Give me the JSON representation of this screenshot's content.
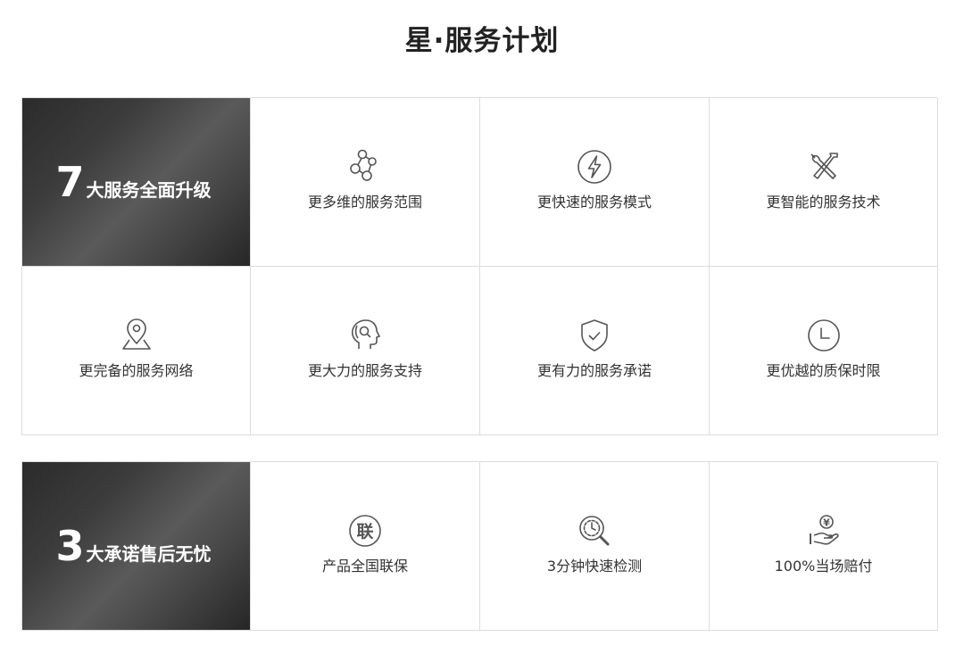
{
  "page": {
    "title": "星·服务计划"
  },
  "upgrades": {
    "hero": {
      "number": "7",
      "text": "大服务全面升级"
    },
    "items": [
      {
        "label": "更多维的服务范围",
        "icon": "molecule-icon"
      },
      {
        "label": "更快速的服务模式",
        "icon": "lightning-icon"
      },
      {
        "label": "更智能的服务技术",
        "icon": "tools-icon"
      },
      {
        "label": "更完备的服务网络",
        "icon": "location-pin-icon"
      },
      {
        "label": "更大力的服务支持",
        "icon": "head-support-icon"
      },
      {
        "label": "更有力的服务承诺",
        "icon": "shield-check-icon"
      },
      {
        "label": "更优越的质保时限",
        "icon": "clock-icon"
      }
    ]
  },
  "promises": {
    "hero": {
      "number": "3",
      "text": "大承诺售后无忧"
    },
    "items": [
      {
        "label": "产品全国联保",
        "icon": "lian-badge-icon",
        "badge_text": "联"
      },
      {
        "label": "3分钟快速检测",
        "icon": "timer-search-icon"
      },
      {
        "label": "100%当场赔付",
        "icon": "hand-coin-icon",
        "coin_symbol": "¥"
      }
    ]
  },
  "colors": {
    "icon_stroke": "#555555",
    "border": "#dcdcdc",
    "hero_dark": "#2b2b2b",
    "hero_light": "#5a5a5a"
  }
}
